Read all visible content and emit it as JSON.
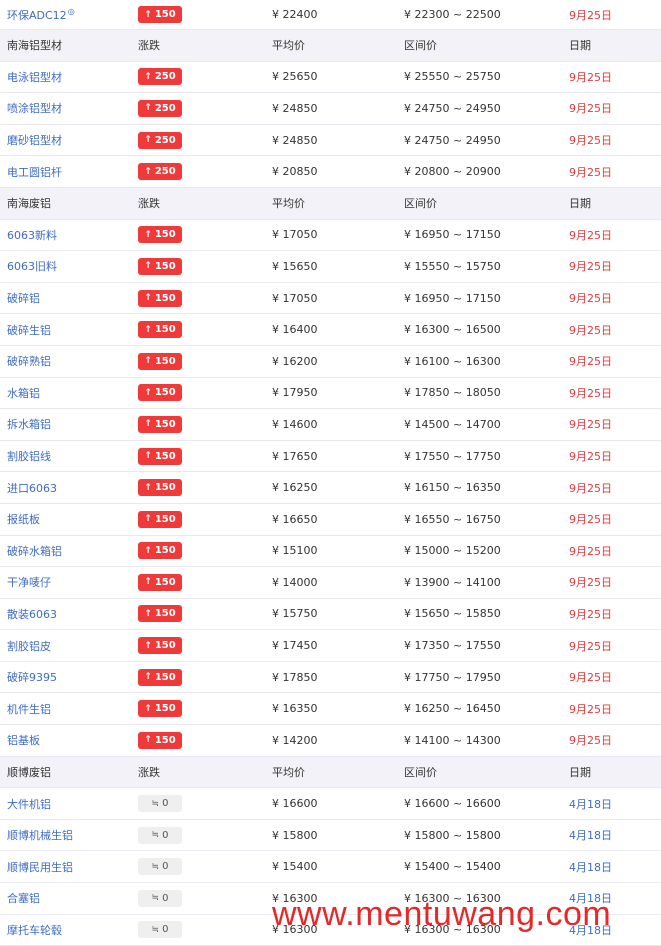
{
  "rows": [
    {
      "kind": "item",
      "name": "环保ADC12",
      "sup": "◎",
      "change": "150",
      "dir": "up",
      "avg": "¥  22400",
      "range": "¥  22300 ~ 22500",
      "date": "9月25日"
    },
    {
      "kind": "header",
      "name": "南海铝型材",
      "change": "涨跌",
      "avg": "平均价",
      "range": "区间价",
      "date": "日期"
    },
    {
      "kind": "item",
      "name": "电泳铝型材",
      "change": "250",
      "dir": "up",
      "avg": "¥  25650",
      "range": "¥  25550 ~ 25750",
      "date": "9月25日"
    },
    {
      "kind": "item",
      "name": "喷涂铝型材",
      "change": "250",
      "dir": "up",
      "avg": "¥  24850",
      "range": "¥  24750 ~ 24950",
      "date": "9月25日"
    },
    {
      "kind": "item",
      "name": "磨砂铝型材",
      "change": "250",
      "dir": "up",
      "avg": "¥  24850",
      "range": "¥  24750 ~ 24950",
      "date": "9月25日"
    },
    {
      "kind": "item",
      "name": "电工圆铝杆",
      "change": "250",
      "dir": "up",
      "avg": "¥  20850",
      "range": "¥  20800 ~ 20900",
      "date": "9月25日"
    },
    {
      "kind": "header",
      "name": "南海废铝",
      "change": "涨跌",
      "avg": "平均价",
      "range": "区间价",
      "date": "日期"
    },
    {
      "kind": "item",
      "name": "6063新料",
      "change": "150",
      "dir": "up",
      "avg": "¥  17050",
      "range": "¥  16950 ~ 17150",
      "date": "9月25日"
    },
    {
      "kind": "item",
      "name": "6063旧料",
      "change": "150",
      "dir": "up",
      "avg": "¥  15650",
      "range": "¥  15550 ~ 15750",
      "date": "9月25日"
    },
    {
      "kind": "item",
      "name": "破碎铝",
      "change": "150",
      "dir": "up",
      "avg": "¥  17050",
      "range": "¥  16950 ~ 17150",
      "date": "9月25日"
    },
    {
      "kind": "item",
      "name": "破碎生铝",
      "change": "150",
      "dir": "up",
      "avg": "¥  16400",
      "range": "¥  16300 ~ 16500",
      "date": "9月25日"
    },
    {
      "kind": "item",
      "name": "破碎熟铝",
      "change": "150",
      "dir": "up",
      "avg": "¥  16200",
      "range": "¥  16100 ~ 16300",
      "date": "9月25日"
    },
    {
      "kind": "item",
      "name": "水箱铝",
      "change": "150",
      "dir": "up",
      "avg": "¥  17950",
      "range": "¥  17850 ~ 18050",
      "date": "9月25日"
    },
    {
      "kind": "item",
      "name": "拆水箱铝",
      "change": "150",
      "dir": "up",
      "avg": "¥  14600",
      "range": "¥  14500 ~ 14700",
      "date": "9月25日"
    },
    {
      "kind": "item",
      "name": "割胶铝线",
      "change": "150",
      "dir": "up",
      "avg": "¥  17650",
      "range": "¥  17550 ~ 17750",
      "date": "9月25日"
    },
    {
      "kind": "item",
      "name": "进口6063",
      "change": "150",
      "dir": "up",
      "avg": "¥  16250",
      "range": "¥  16150 ~ 16350",
      "date": "9月25日"
    },
    {
      "kind": "item",
      "name": "报纸板",
      "change": "150",
      "dir": "up",
      "avg": "¥  16650",
      "range": "¥  16550 ~ 16750",
      "date": "9月25日"
    },
    {
      "kind": "item",
      "name": "破碎水箱铝",
      "change": "150",
      "dir": "up",
      "avg": "¥  15100",
      "range": "¥  15000 ~ 15200",
      "date": "9月25日"
    },
    {
      "kind": "item",
      "name": "干净唛仔",
      "change": "150",
      "dir": "up",
      "avg": "¥  14000",
      "range": "¥  13900 ~ 14100",
      "date": "9月25日"
    },
    {
      "kind": "item",
      "name": "散装6063",
      "change": "150",
      "dir": "up",
      "avg": "¥  15750",
      "range": "¥  15650 ~ 15850",
      "date": "9月25日"
    },
    {
      "kind": "item",
      "name": "割胶铝皮",
      "change": "150",
      "dir": "up",
      "avg": "¥  17450",
      "range": "¥  17350 ~ 17550",
      "date": "9月25日"
    },
    {
      "kind": "item",
      "name": "破碎9395",
      "change": "150",
      "dir": "up",
      "avg": "¥  17850",
      "range": "¥  17750 ~ 17950",
      "date": "9月25日"
    },
    {
      "kind": "item",
      "name": "机件生铝",
      "change": "150",
      "dir": "up",
      "avg": "¥  16350",
      "range": "¥  16250 ~ 16450",
      "date": "9月25日"
    },
    {
      "kind": "item",
      "name": "铝基板",
      "change": "150",
      "dir": "up",
      "avg": "¥  14200",
      "range": "¥  14100 ~ 14300",
      "date": "9月25日"
    },
    {
      "kind": "header",
      "name": "顺博废铝",
      "change": "涨跌",
      "avg": "平均价",
      "range": "区间价",
      "date": "日期"
    },
    {
      "kind": "item",
      "name": "大件机铝",
      "change": "0",
      "dir": "flat",
      "avg": "¥  16600",
      "range": "¥  16600 ~ 16600",
      "date": "4月18日"
    },
    {
      "kind": "item",
      "name": "顺博机械生铝",
      "change": "0",
      "dir": "flat",
      "avg": "¥  15800",
      "range": "¥  15800 ~ 15800",
      "date": "4月18日"
    },
    {
      "kind": "item",
      "name": "顺博民用生铝",
      "change": "0",
      "dir": "flat",
      "avg": "¥  15400",
      "range": "¥  15400 ~ 15400",
      "date": "4月18日"
    },
    {
      "kind": "item",
      "name": "合塞铝",
      "change": "0",
      "dir": "flat",
      "avg": "¥  16300",
      "range": "¥  16300 ~ 16300",
      "date": "4月18日"
    },
    {
      "kind": "item",
      "name": "摩托车轮毂",
      "change": "0",
      "dir": "flat",
      "avg": "¥  16300",
      "range": "¥  16300 ~ 16300",
      "date": "4月18日"
    }
  ],
  "icons": {
    "up": "↑",
    "flat": "≒"
  },
  "watermark": "www.mentuwang.com",
  "colors": {
    "up_badge": "#f03a3a",
    "link": "#3f6cc4",
    "date_red": "#e8393b",
    "header_bg": "#f3f2f8"
  }
}
